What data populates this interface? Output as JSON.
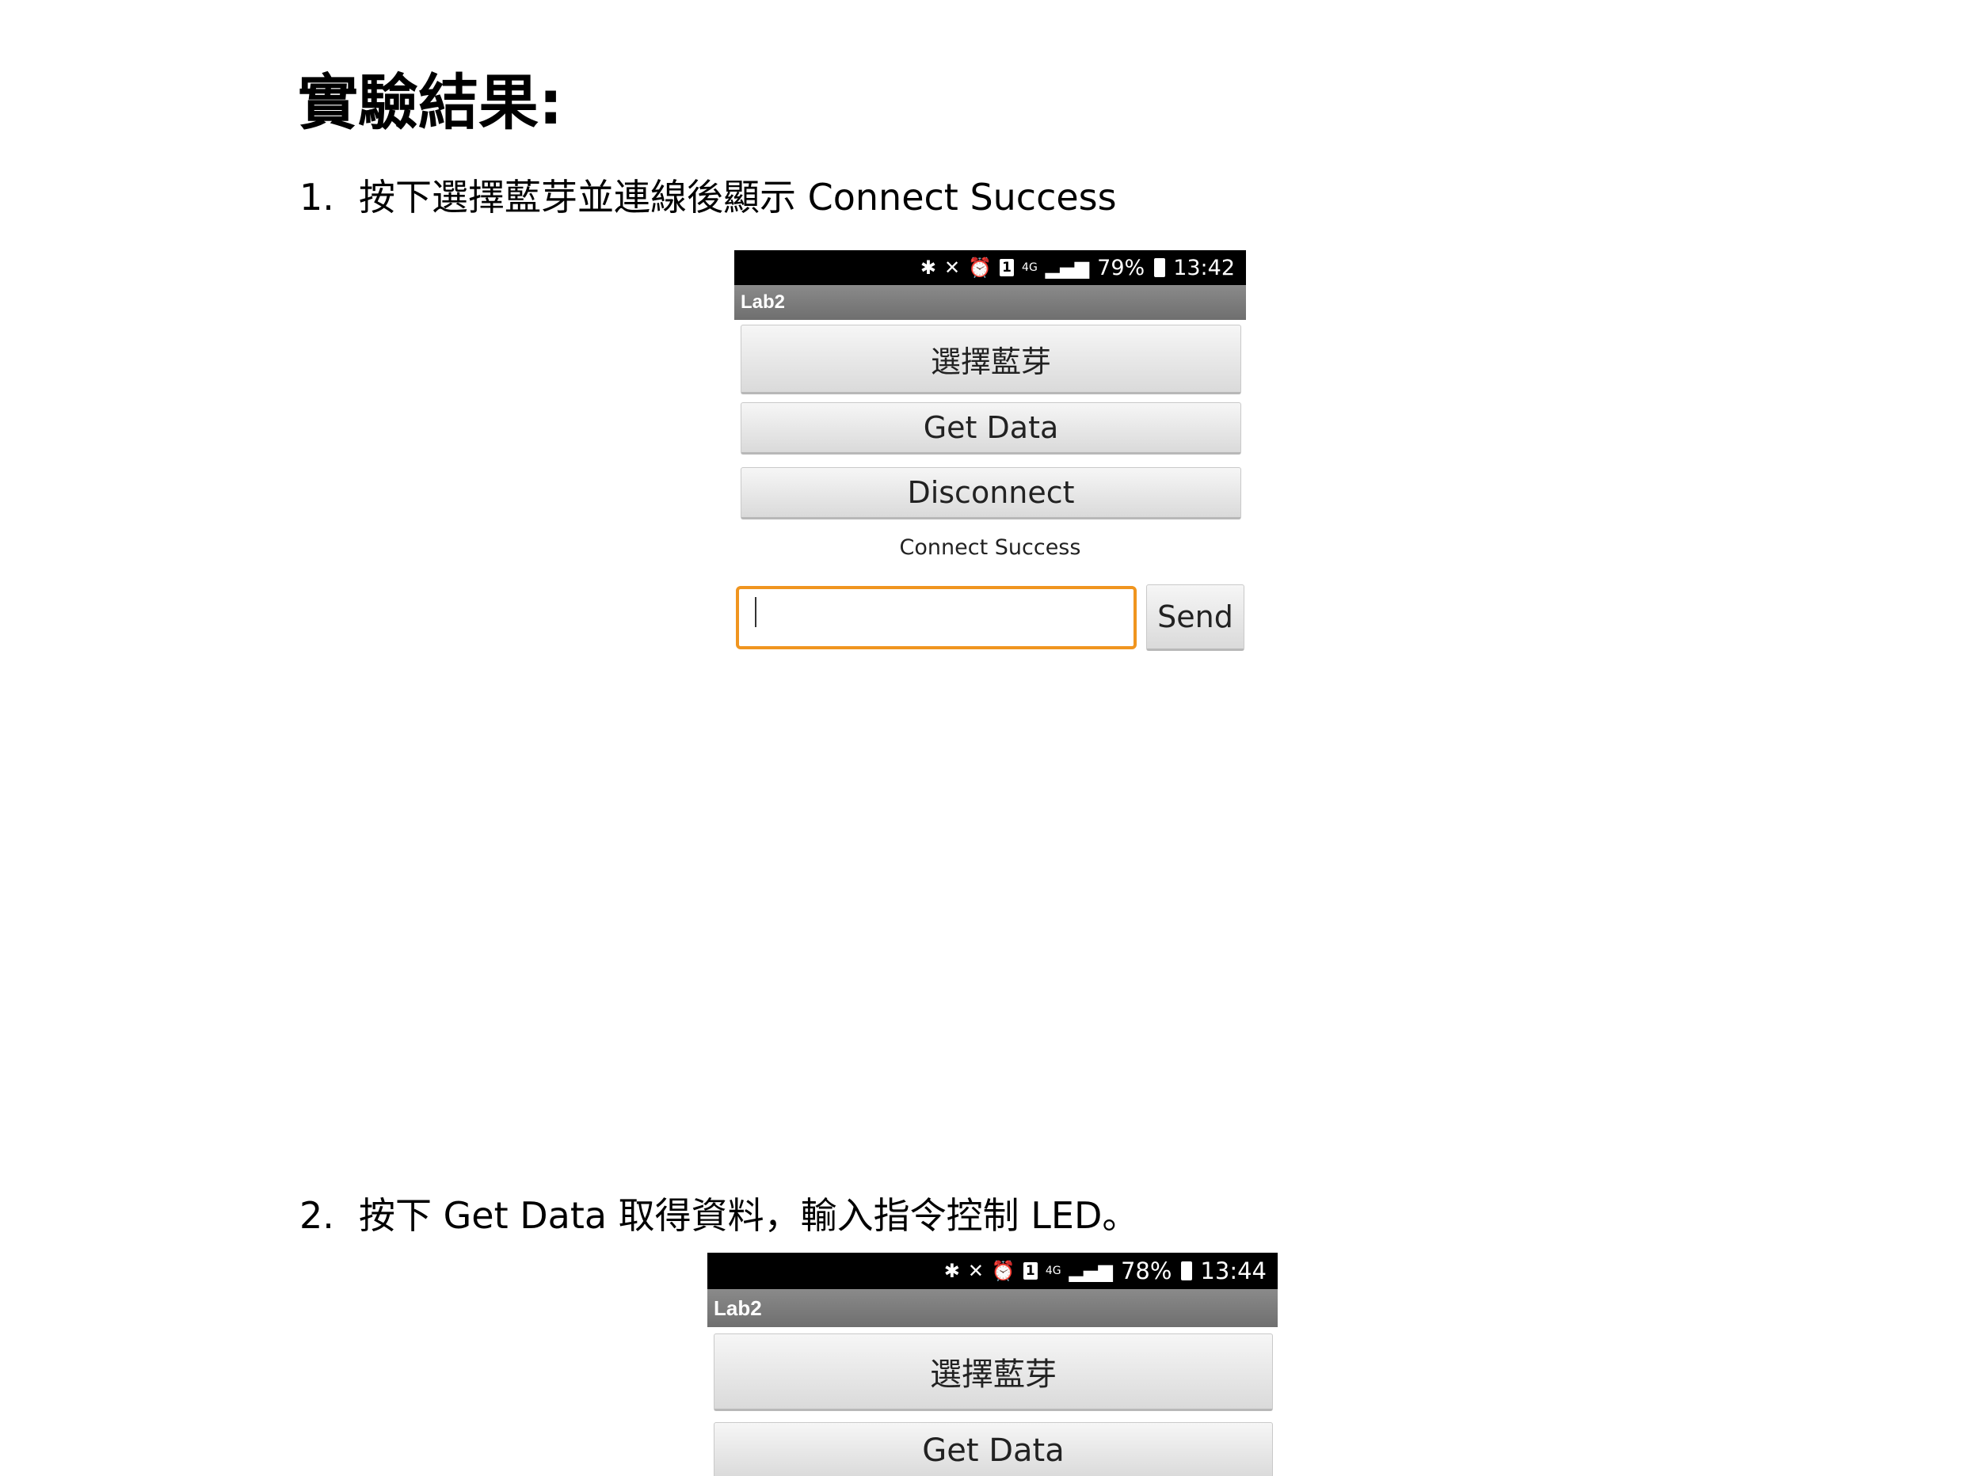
{
  "heading": "實驗結果:",
  "step1": {
    "num": "1.",
    "text": "按下選擇藍芽並連線後顯示 Connect Success"
  },
  "step2": {
    "num": "2.",
    "text": "按下 Get Data 取得資料，輸入指令控制 LED。"
  },
  "screenshot1": {
    "status": {
      "battery": "79%",
      "time": "13:42",
      "sim": "1",
      "network": "4G"
    },
    "app_title": "Lab2",
    "select_bt_label": "選擇藍芽",
    "get_data_label": "Get Data",
    "disconnect_label": "Disconnect",
    "status_text": "Connect Success",
    "input_value": "",
    "send_label": "Send"
  },
  "screenshot2": {
    "status": {
      "battery": "78%",
      "time": "13:44",
      "sim": "1",
      "network": "4G"
    },
    "app_title": "Lab2",
    "select_bt_label": "選擇藍芽",
    "get_data_label": "Get Data"
  }
}
